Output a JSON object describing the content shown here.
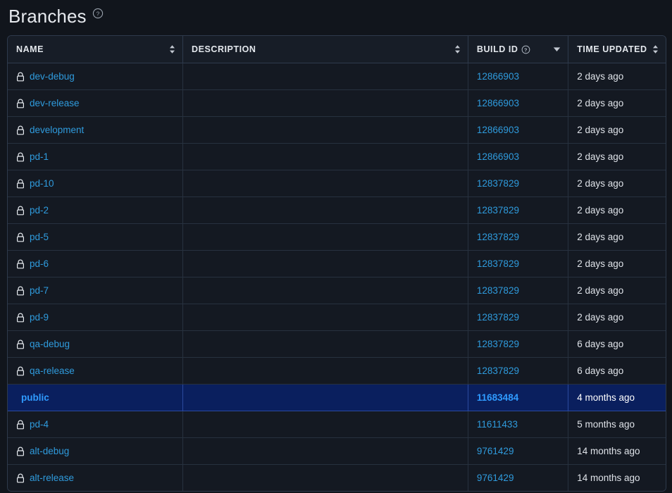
{
  "header": {
    "title": "Branches",
    "help_icon": "help-circle-icon"
  },
  "table": {
    "columns": [
      {
        "key": "name",
        "label": "NAME",
        "sort": "both",
        "help": false
      },
      {
        "key": "desc",
        "label": "DESCRIPTION",
        "sort": "both",
        "help": false
      },
      {
        "key": "build",
        "label": "BUILD ID",
        "sort": "desc",
        "help": true,
        "help_icon": "help-circle-icon"
      },
      {
        "key": "time",
        "label": "TIME UPDATED",
        "sort": "both",
        "help": false
      }
    ],
    "rows": [
      {
        "name": "dev-debug",
        "locked": true,
        "description": "",
        "build_id": "12866903",
        "time_updated": "2 days ago",
        "selected": false
      },
      {
        "name": "dev-release",
        "locked": true,
        "description": "",
        "build_id": "12866903",
        "time_updated": "2 days ago",
        "selected": false
      },
      {
        "name": "development",
        "locked": true,
        "description": "",
        "build_id": "12866903",
        "time_updated": "2 days ago",
        "selected": false
      },
      {
        "name": "pd-1",
        "locked": true,
        "description": "",
        "build_id": "12866903",
        "time_updated": "2 days ago",
        "selected": false
      },
      {
        "name": "pd-10",
        "locked": true,
        "description": "",
        "build_id": "12837829",
        "time_updated": "2 days ago",
        "selected": false
      },
      {
        "name": "pd-2",
        "locked": true,
        "description": "",
        "build_id": "12837829",
        "time_updated": "2 days ago",
        "selected": false
      },
      {
        "name": "pd-5",
        "locked": true,
        "description": "",
        "build_id": "12837829",
        "time_updated": "2 days ago",
        "selected": false
      },
      {
        "name": "pd-6",
        "locked": true,
        "description": "",
        "build_id": "12837829",
        "time_updated": "2 days ago",
        "selected": false
      },
      {
        "name": "pd-7",
        "locked": true,
        "description": "",
        "build_id": "12837829",
        "time_updated": "2 days ago",
        "selected": false
      },
      {
        "name": "pd-9",
        "locked": true,
        "description": "",
        "build_id": "12837829",
        "time_updated": "2 days ago",
        "selected": false
      },
      {
        "name": "qa-debug",
        "locked": true,
        "description": "",
        "build_id": "12837829",
        "time_updated": "6 days ago",
        "selected": false
      },
      {
        "name": "qa-release",
        "locked": true,
        "description": "",
        "build_id": "12837829",
        "time_updated": "6 days ago",
        "selected": false
      },
      {
        "name": "public",
        "locked": false,
        "description": "",
        "build_id": "11683484",
        "time_updated": "4 months ago",
        "selected": true
      },
      {
        "name": "pd-4",
        "locked": true,
        "description": "",
        "build_id": "11611433",
        "time_updated": "5 months ago",
        "selected": false
      },
      {
        "name": "alt-debug",
        "locked": true,
        "description": "",
        "build_id": "9761429",
        "time_updated": "14 months ago",
        "selected": false
      },
      {
        "name": "alt-release",
        "locked": true,
        "description": "",
        "build_id": "9761429",
        "time_updated": "14 months ago",
        "selected": false
      }
    ]
  },
  "colors": {
    "page_background": "#11151c",
    "table_background": "#141922",
    "header_background": "#171d27",
    "border": "#2e3a4c",
    "row_border": "#27313f",
    "link": "#2f9bdd",
    "selected_row_background": "#0a1f5e",
    "selected_link": "#2f9bff",
    "text": "#dfe3e9"
  }
}
